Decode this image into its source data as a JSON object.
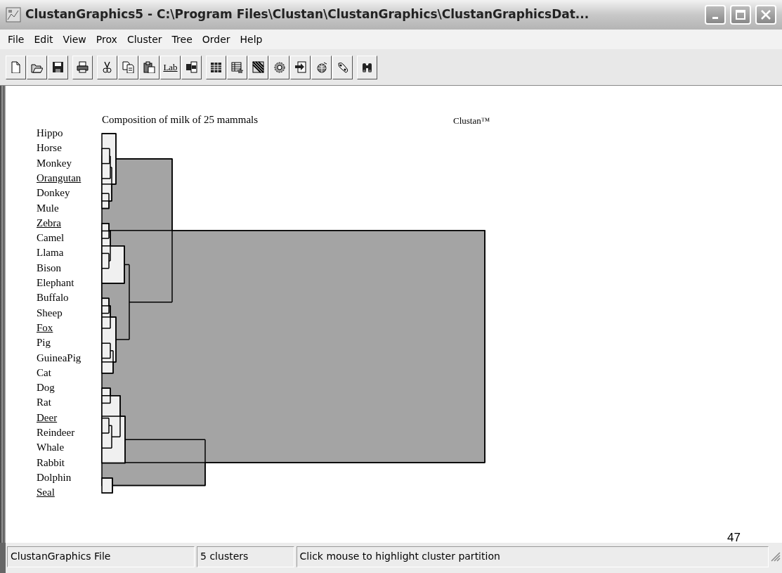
{
  "window": {
    "title": "ClustanGraphics5 - C:\\Program Files\\Clustan\\ClustanGraphics\\ClustanGraphicsDat..."
  },
  "menu": [
    "File",
    "Edit",
    "View",
    "Prox",
    "Cluster",
    "Tree",
    "Order",
    "Help"
  ],
  "toolbar": [
    {
      "kind": "icon"
    },
    {
      "kind": "icon"
    },
    {
      "kind": "icon"
    },
    {
      "kind": "gap"
    },
    {
      "kind": "icon"
    },
    {
      "kind": "gap"
    },
    {
      "kind": "icon"
    },
    {
      "kind": "icon"
    },
    {
      "kind": "icon"
    },
    {
      "kind": "text",
      "label": "Lab"
    },
    {
      "kind": "icon"
    },
    {
      "kind": "gap"
    },
    {
      "kind": "icon"
    },
    {
      "kind": "icon"
    },
    {
      "kind": "icon"
    },
    {
      "kind": "icon"
    },
    {
      "kind": "icon"
    },
    {
      "kind": "icon"
    },
    {
      "kind": "icon"
    },
    {
      "kind": "gap"
    },
    {
      "kind": "icon"
    }
  ],
  "dendrogram": {
    "title": "Composition of milk of 25 mammals",
    "brand": "Clustan™",
    "leaves": [
      {
        "label": "Hippo",
        "underlined": false
      },
      {
        "label": "Horse",
        "underlined": false
      },
      {
        "label": "Monkey",
        "underlined": false
      },
      {
        "label": "Orangutan",
        "underlined": true
      },
      {
        "label": "Donkey",
        "underlined": false
      },
      {
        "label": "Mule",
        "underlined": false
      },
      {
        "label": "Zebra",
        "underlined": true
      },
      {
        "label": "Camel",
        "underlined": false
      },
      {
        "label": "Llama",
        "underlined": false
      },
      {
        "label": "Bison",
        "underlined": false
      },
      {
        "label": "Elephant",
        "underlined": false
      },
      {
        "label": "Buffalo",
        "underlined": false
      },
      {
        "label": "Sheep",
        "underlined": false
      },
      {
        "label": "Fox",
        "underlined": true
      },
      {
        "label": "Pig",
        "underlined": false
      },
      {
        "label": "GuineaPig",
        "underlined": false
      },
      {
        "label": "Cat",
        "underlined": false
      },
      {
        "label": "Dog",
        "underlined": false
      },
      {
        "label": "Rat",
        "underlined": false
      },
      {
        "label": "Deer",
        "underlined": true
      },
      {
        "label": "Reindeer",
        "underlined": false
      },
      {
        "label": "Whale",
        "underlined": false
      },
      {
        "label": "Rabbit",
        "underlined": false
      },
      {
        "label": "Dolphin",
        "underlined": false
      },
      {
        "label": "Seal",
        "underlined": true
      }
    ]
  },
  "page_number": "47",
  "status_bar": [
    "ClustanGraphics File",
    "5 clusters",
    "Click mouse to highlight cluster partition"
  ]
}
